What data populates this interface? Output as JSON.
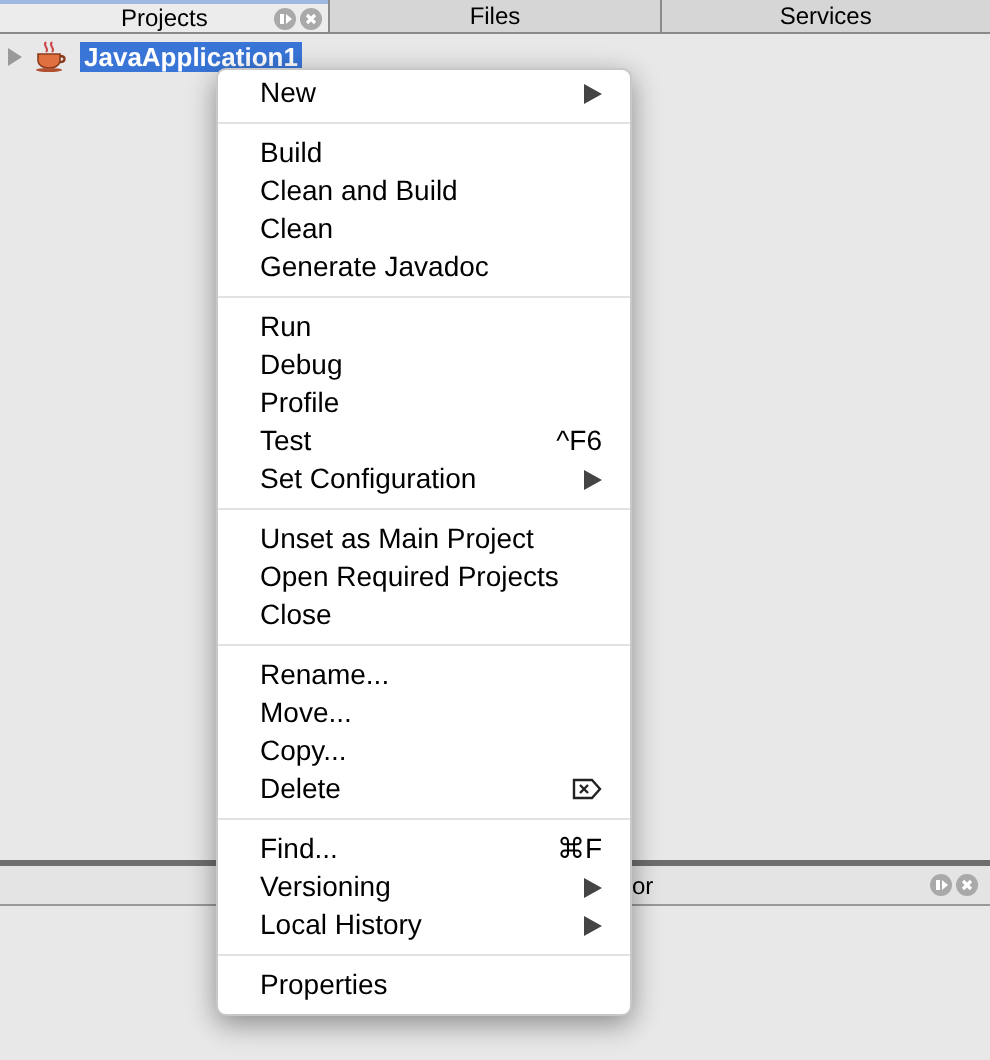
{
  "tabs": [
    {
      "label": "Projects",
      "selected": true
    },
    {
      "label": "Files",
      "selected": false
    },
    {
      "label": "Services",
      "selected": false
    }
  ],
  "tree": [
    {
      "label": "JavaApplication1",
      "selected": true,
      "expanded": false
    }
  ],
  "bottom_panel": {
    "title": "or"
  },
  "context_menu": {
    "sections": [
      [
        {
          "label": "New",
          "kind": "submenu"
        }
      ],
      [
        {
          "label": "Build",
          "kind": "plain"
        },
        {
          "label": "Clean and Build",
          "kind": "plain"
        },
        {
          "label": "Clean",
          "kind": "plain"
        },
        {
          "label": "Generate Javadoc",
          "kind": "plain"
        }
      ],
      [
        {
          "label": "Run",
          "kind": "plain"
        },
        {
          "label": "Debug",
          "kind": "plain"
        },
        {
          "label": "Profile",
          "kind": "plain"
        },
        {
          "label": "Test",
          "kind": "shortcut",
          "shortcut": "^F6"
        },
        {
          "label": "Set Configuration",
          "kind": "submenu"
        }
      ],
      [
        {
          "label": "Unset as Main Project",
          "kind": "plain"
        },
        {
          "label": "Open Required Projects",
          "kind": "plain"
        },
        {
          "label": "Close",
          "kind": "plain"
        }
      ],
      [
        {
          "label": "Rename...",
          "kind": "plain"
        },
        {
          "label": "Move...",
          "kind": "plain"
        },
        {
          "label": "Copy...",
          "kind": "plain"
        },
        {
          "label": "Delete",
          "kind": "delete"
        }
      ],
      [
        {
          "label": "Find...",
          "kind": "shortcut",
          "shortcut": "⌘F"
        },
        {
          "label": "Versioning",
          "kind": "submenu"
        },
        {
          "label": "Local History",
          "kind": "submenu"
        }
      ],
      [
        {
          "label": "Properties",
          "kind": "plain"
        }
      ]
    ]
  }
}
